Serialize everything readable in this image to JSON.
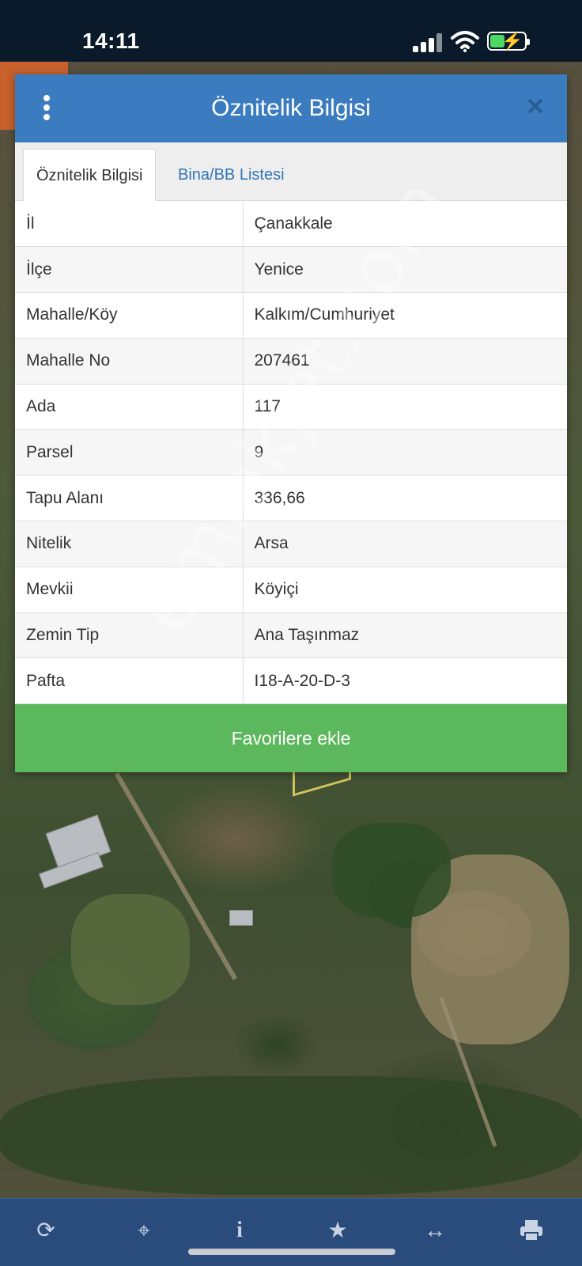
{
  "status_bar": {
    "time": "14:11"
  },
  "dialog": {
    "title": "Öznitelik Bilgisi",
    "tabs": [
      {
        "label": "Öznitelik Bilgisi",
        "active": true
      },
      {
        "label": "Bina/BB Listesi",
        "active": false
      }
    ],
    "rows": [
      {
        "key": "İl",
        "value": "Çanakkale"
      },
      {
        "key": "İlçe",
        "value": "Yenice"
      },
      {
        "key": "Mahalle/Köy",
        "value": "Kalkım/Cumhuriyet"
      },
      {
        "key": "Mahalle No",
        "value": "207461"
      },
      {
        "key": "Ada",
        "value": "117"
      },
      {
        "key": "Parsel",
        "value": "9"
      },
      {
        "key": "Tapu Alanı",
        "value": "336,66"
      },
      {
        "key": "Nitelik",
        "value": "Arsa"
      },
      {
        "key": "Mevkii",
        "value": "Köyiçi"
      },
      {
        "key": "Zemin Tip",
        "value": "Ana Taşınmaz"
      },
      {
        "key": "Pafta",
        "value": "I18-A-20-D-3"
      }
    ],
    "favorite_button": "Favorilere ekle"
  },
  "watermark": "emlakjet.com",
  "toolbar": {
    "icons": [
      "refresh-icon",
      "locate-icon",
      "info-icon",
      "star-icon",
      "measure-icon",
      "print-icon"
    ]
  },
  "colors": {
    "header": "#3b7bbf",
    "favorite": "#5cb85c",
    "toolbar": "#2a4c7c"
  }
}
